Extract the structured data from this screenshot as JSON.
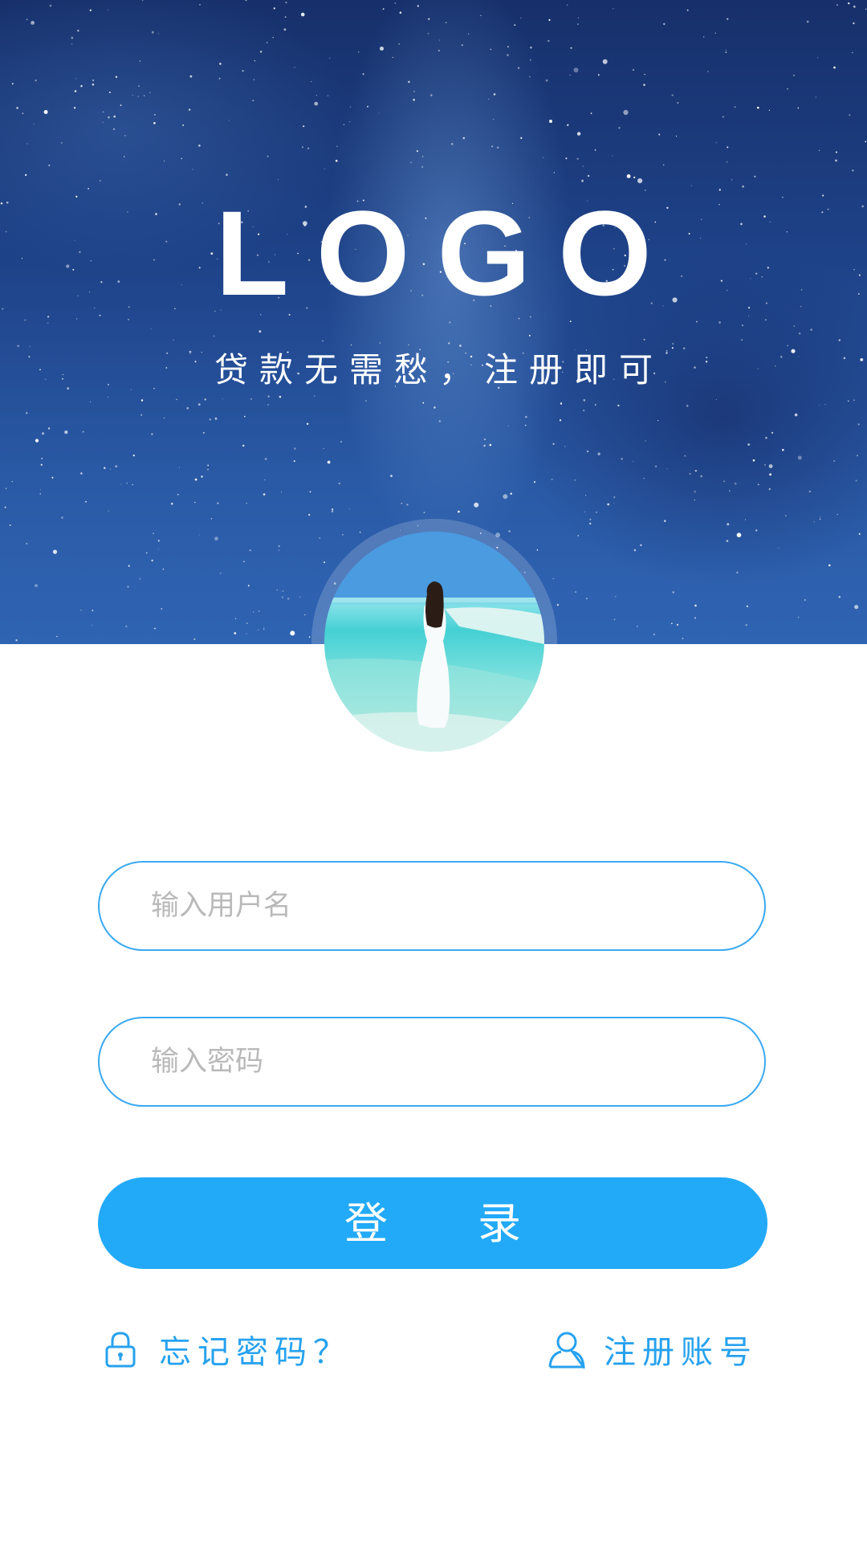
{
  "hero": {
    "logo_text": "LOGO",
    "tagline": "贷款无需愁，注册即可"
  },
  "avatar": {
    "icon": "beach-photo-avatar"
  },
  "form": {
    "username_placeholder": "输入用户名",
    "password_placeholder": "输入密码",
    "login_label": "登录"
  },
  "links": {
    "forgot_label": "忘记密码？",
    "forgot_icon": "lock-icon",
    "register_label": "注册账号",
    "register_icon": "user-icon"
  },
  "colors": {
    "accent": "#22aaf8",
    "input_border": "#3aa9f2",
    "link": "#27a2ee",
    "hero_dark": "#17306b",
    "hero_light": "#2f64b3"
  }
}
